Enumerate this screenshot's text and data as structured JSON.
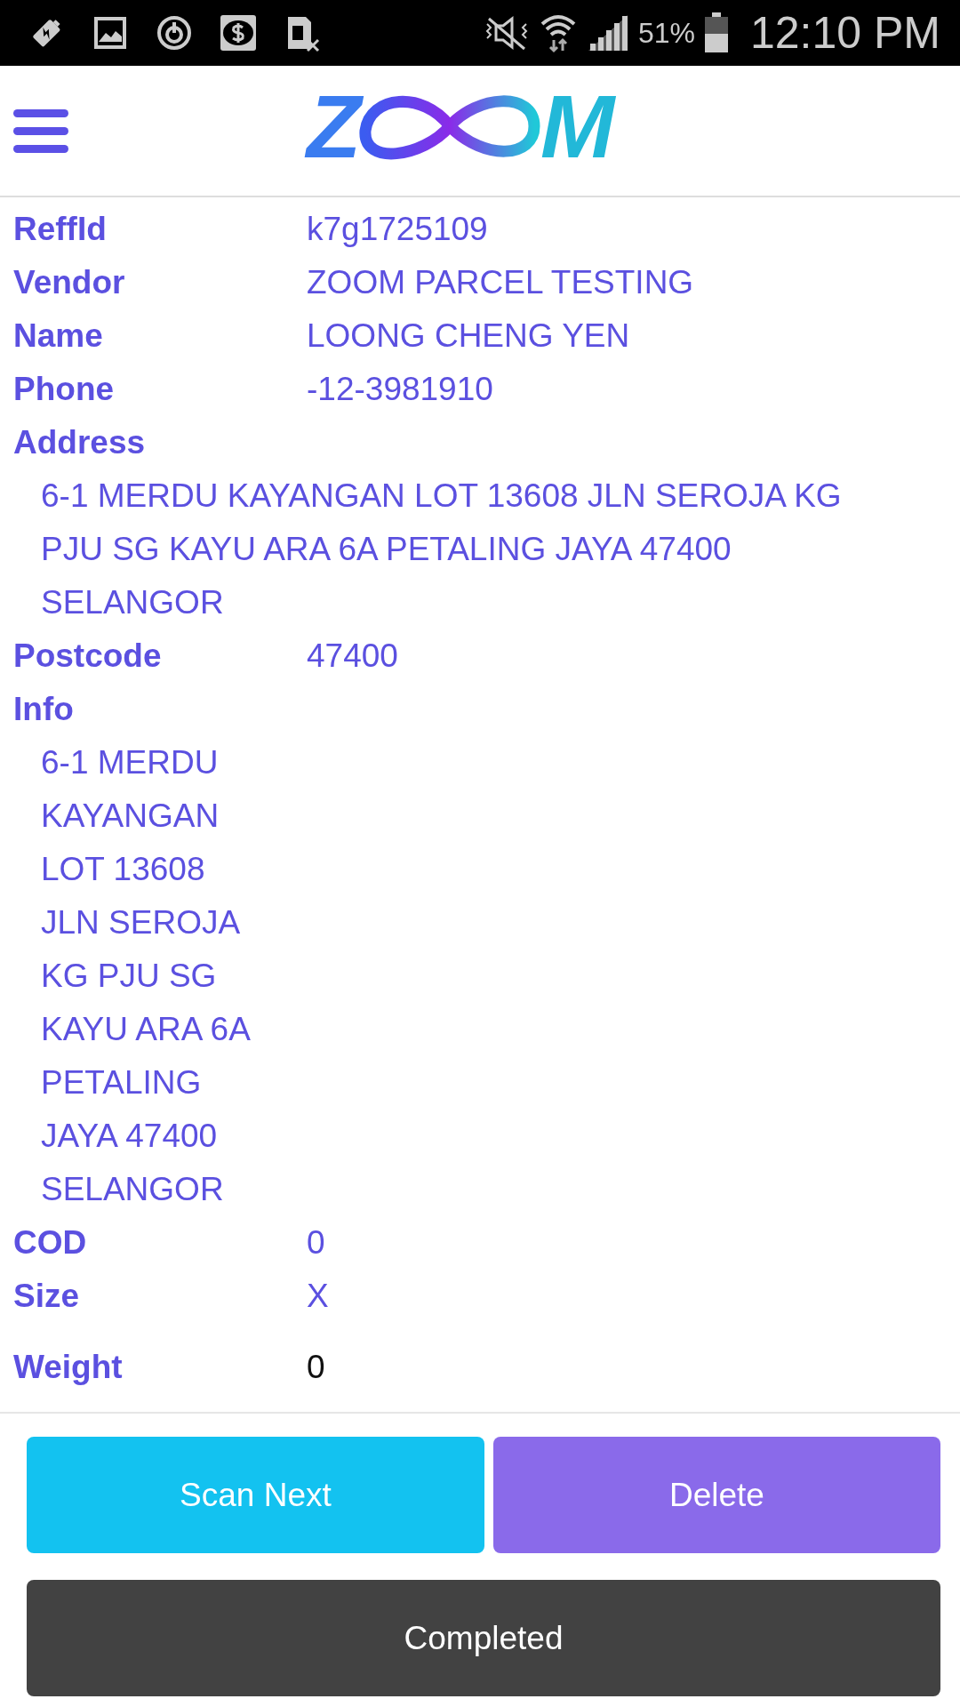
{
  "status_bar": {
    "battery": "51%",
    "time": "12:10 PM"
  },
  "logo": {
    "left": "Z",
    "right": "M"
  },
  "fields": [
    {
      "kind": "inline",
      "label": "ReffId",
      "value": "k7g1725109"
    },
    {
      "kind": "inline",
      "label": "Vendor",
      "value": "ZOOM PARCEL TESTING"
    },
    {
      "kind": "inline",
      "label": "Name",
      "value": "LOONG CHENG YEN"
    },
    {
      "kind": "inline",
      "label": "Phone",
      "value": "-12-3981910"
    },
    {
      "kind": "block",
      "label": "Address",
      "lines": [
        "6-1 MERDU KAYANGAN LOT 13608 JLN SEROJA KG",
        "PJU SG KAYU ARA 6A PETALING JAYA 47400",
        "SELANGOR"
      ]
    },
    {
      "kind": "inline",
      "label": "Postcode",
      "value": "47400"
    },
    {
      "kind": "block",
      "label": "Info",
      "lines": [
        "6-1 MERDU",
        "KAYANGAN",
        "LOT 13608",
        "JLN SEROJA",
        "KG PJU SG",
        "KAYU ARA 6A",
        "PETALING",
        "JAYA 47400",
        "SELANGOR"
      ]
    },
    {
      "kind": "inline",
      "label": "COD",
      "value": "0"
    },
    {
      "kind": "inline",
      "label": "Size",
      "value": "X"
    },
    {
      "kind": "input",
      "label": "Weight",
      "value": "0"
    }
  ],
  "buttons": [
    {
      "kind": "scan",
      "label": "Scan Next"
    },
    {
      "kind": "delete",
      "label": "Delete"
    },
    {
      "kind": "complete",
      "label": "Completed"
    }
  ]
}
